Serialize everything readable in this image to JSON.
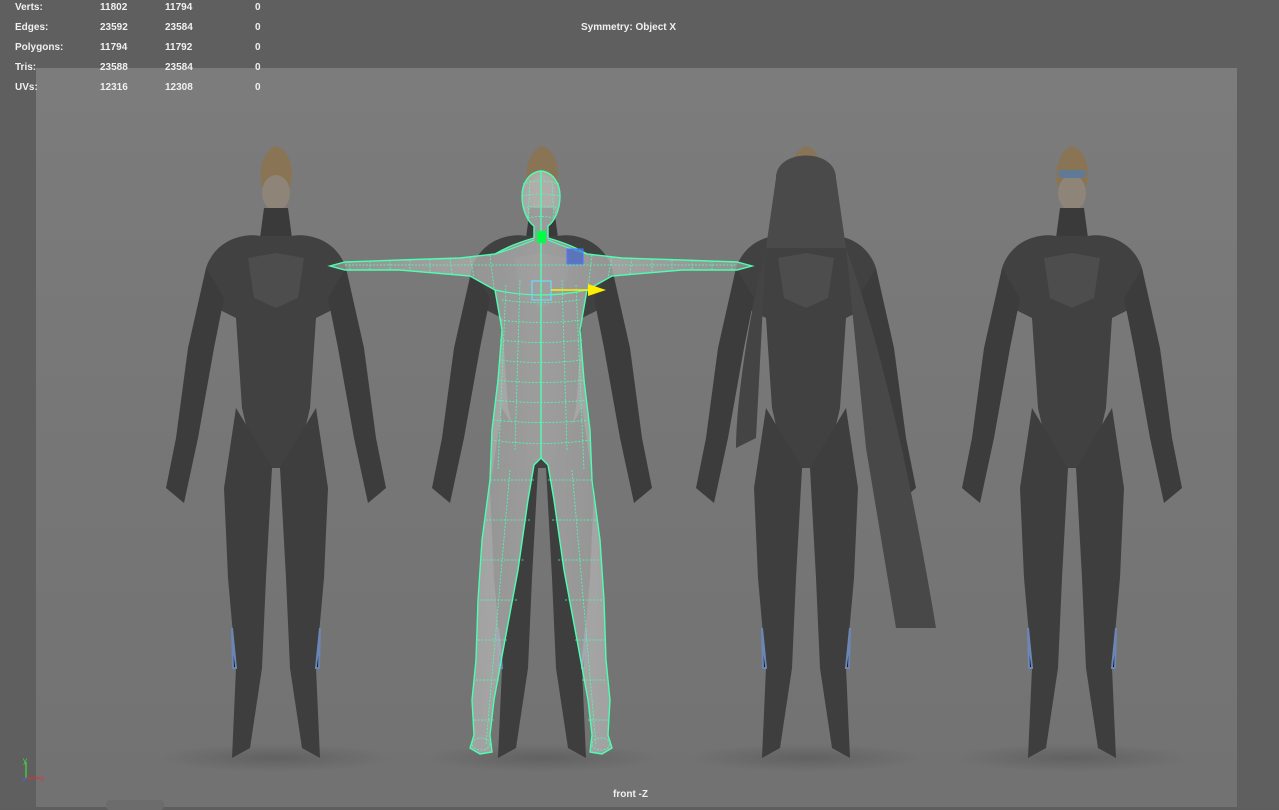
{
  "hud": {
    "rows": [
      {
        "label": "Verts:",
        "v1": "11802",
        "v2": "11794",
        "v3": "0"
      },
      {
        "label": "Edges:",
        "v1": "23592",
        "v2": "23584",
        "v3": "0"
      },
      {
        "label": "Polygons:",
        "v1": "11794",
        "v2": "11792",
        "v3": "0"
      },
      {
        "label": "Tris:",
        "v1": "23588",
        "v2": "23584",
        "v3": "0"
      },
      {
        "label": "UVs:",
        "v1": "12316",
        "v2": "12308",
        "v3": "0"
      }
    ]
  },
  "viewport": {
    "symmetry": "Symmetry: Object X",
    "camera": "front -Z"
  },
  "axis": {
    "y_label": "y",
    "x_label": "x"
  },
  "colors": {
    "wireframe": "#4dffb0",
    "manipulator_x": "#ffee00",
    "manipulator_center": "#66ddff",
    "selected_joint": "#00ff44",
    "plane_handle": "#2a55d8",
    "viewport_bg": "#5f5f5f",
    "image_plane": "#787878"
  },
  "icons": {
    "axis": "axis-gizmo-icon",
    "move": "move-manipulator-icon"
  }
}
